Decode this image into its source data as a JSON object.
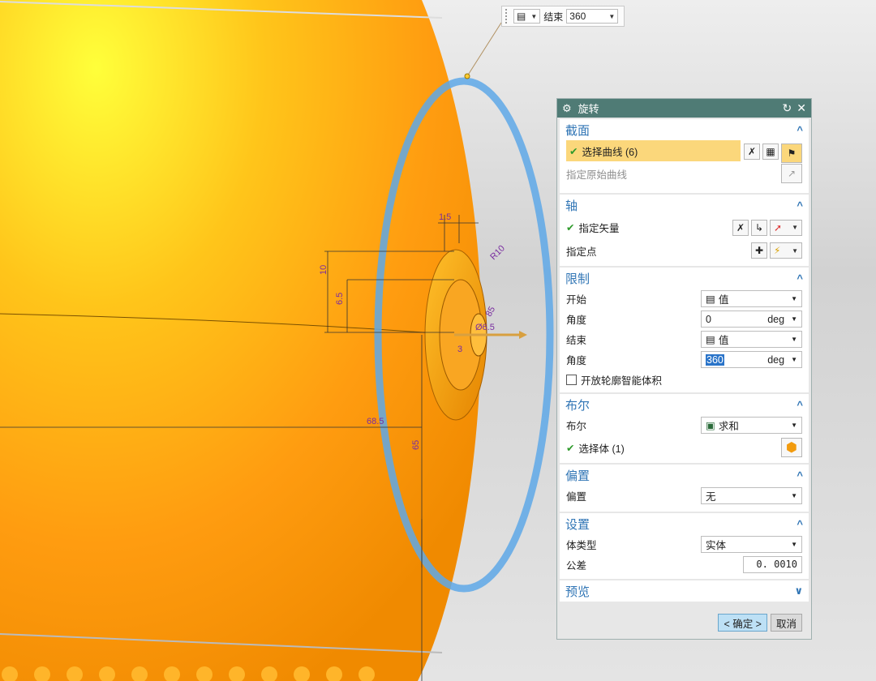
{
  "mini_toolbar": {
    "icon": "value-type-icon",
    "end_label": "结束",
    "end_value": "360"
  },
  "dimensions": {
    "d1": "1.5",
    "d2": "R10",
    "d3": "10",
    "d4": "6.5",
    "d5": "3",
    "d6": "68.5",
    "d7": "65",
    "d8": "85",
    "d9": "Ø6.5"
  },
  "dialog": {
    "title": "旋转",
    "sections": {
      "section": {
        "header": "截面",
        "select_curve": "选择曲线 (6)",
        "original_curve": "指定原始曲线"
      },
      "axis": {
        "header": "轴",
        "vector": "指定矢量",
        "point": "指定点"
      },
      "limits": {
        "header": "限制",
        "start_label": "开始",
        "start_value": "值",
        "angle1_label": "角度",
        "angle1_value": "0",
        "angle1_unit": "deg",
        "end_label": "结束",
        "end_value": "值",
        "angle2_label": "角度",
        "angle2_value": "360",
        "angle2_unit": "deg",
        "open_profile": "开放轮廓智能体积"
      },
      "boolean": {
        "header": "布尔",
        "label": "布尔",
        "value": "求和",
        "select_body": "选择体 (1)"
      },
      "offset": {
        "header": "偏置",
        "label": "偏置",
        "value": "无"
      },
      "settings": {
        "header": "设置",
        "body_type_label": "体类型",
        "body_type_value": "实体",
        "tolerance_label": "公差",
        "tolerance_value": "0. 0010"
      },
      "preview": {
        "header": "预览"
      }
    },
    "ok_label": "< 确定 >",
    "cancel_label": "取消"
  },
  "colors": {
    "title_bar": "#4f7b75",
    "section_header": "#3075b5",
    "highlight": "#fbd77b",
    "body": "#ffa020",
    "ring": "#5ea8e8"
  }
}
